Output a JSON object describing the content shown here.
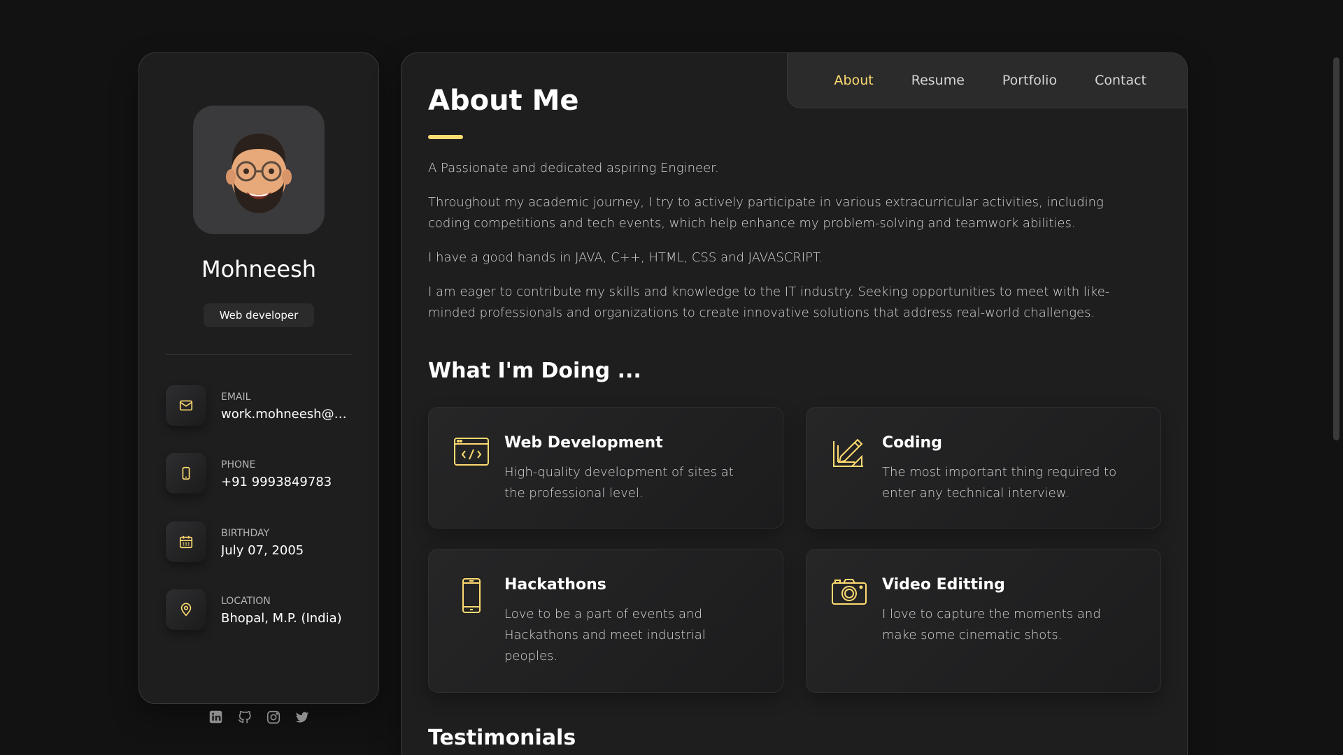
{
  "sidebar": {
    "name": "Mohneesh",
    "title": "Web developer",
    "contacts": [
      {
        "label": "Email",
        "value": "work.mohneesh@gmail.com",
        "icon": "mail-icon"
      },
      {
        "label": "Phone",
        "value": "+91 9993849783",
        "icon": "phone-icon"
      },
      {
        "label": "Birthday",
        "value": "July 07, 2005",
        "icon": "calendar-icon"
      },
      {
        "label": "Location",
        "value": "Bhopal, M.P. (India)",
        "icon": "location-pin-icon"
      }
    ],
    "socials": [
      "linkedin-icon",
      "github-icon",
      "instagram-icon",
      "twitter-icon"
    ]
  },
  "nav": {
    "items": [
      {
        "label": "About",
        "active": true
      },
      {
        "label": "Resume",
        "active": false
      },
      {
        "label": "Portfolio",
        "active": false
      },
      {
        "label": "Contact",
        "active": false
      }
    ]
  },
  "about": {
    "title": "About Me",
    "paragraphs": [
      "A Passionate and dedicated aspiring Engineer.",
      "Throughout my academic journey, I try to actively participate in various extracurricular activities, including coding competitions and tech events, which help enhance my problem-solving and teamwork abilities.",
      "I have a good hands in JAVA, C++, HTML, CSS and JAVASCRIPT.",
      "I am eager to contribute my skills and knowledge to the IT industry. Seeking opportunities to meet with like-minded professionals and organizations to create innovative solutions that address real-world challenges."
    ]
  },
  "services": {
    "title": "What I'm Doing ...",
    "items": [
      {
        "title": "Web Development",
        "text": "High-quality development of sites at the professional level.",
        "icon": "web-code-icon"
      },
      {
        "title": "Coding",
        "text": "The most important thing required to enter any technical interview.",
        "icon": "design-pencil-icon"
      },
      {
        "title": "Hackathons",
        "text": "Love to be a part of events and Hackathons and meet industrial peoples.",
        "icon": "mobile-icon"
      },
      {
        "title": "Video Editting",
        "text": "I love to capture the moments and make some cinematic shots.",
        "icon": "camera-icon"
      }
    ]
  },
  "testimonials": {
    "title": "Testimonials"
  },
  "colors": {
    "accent": "#ffdb70",
    "background": "#121212",
    "card": "#1e1e1f"
  }
}
